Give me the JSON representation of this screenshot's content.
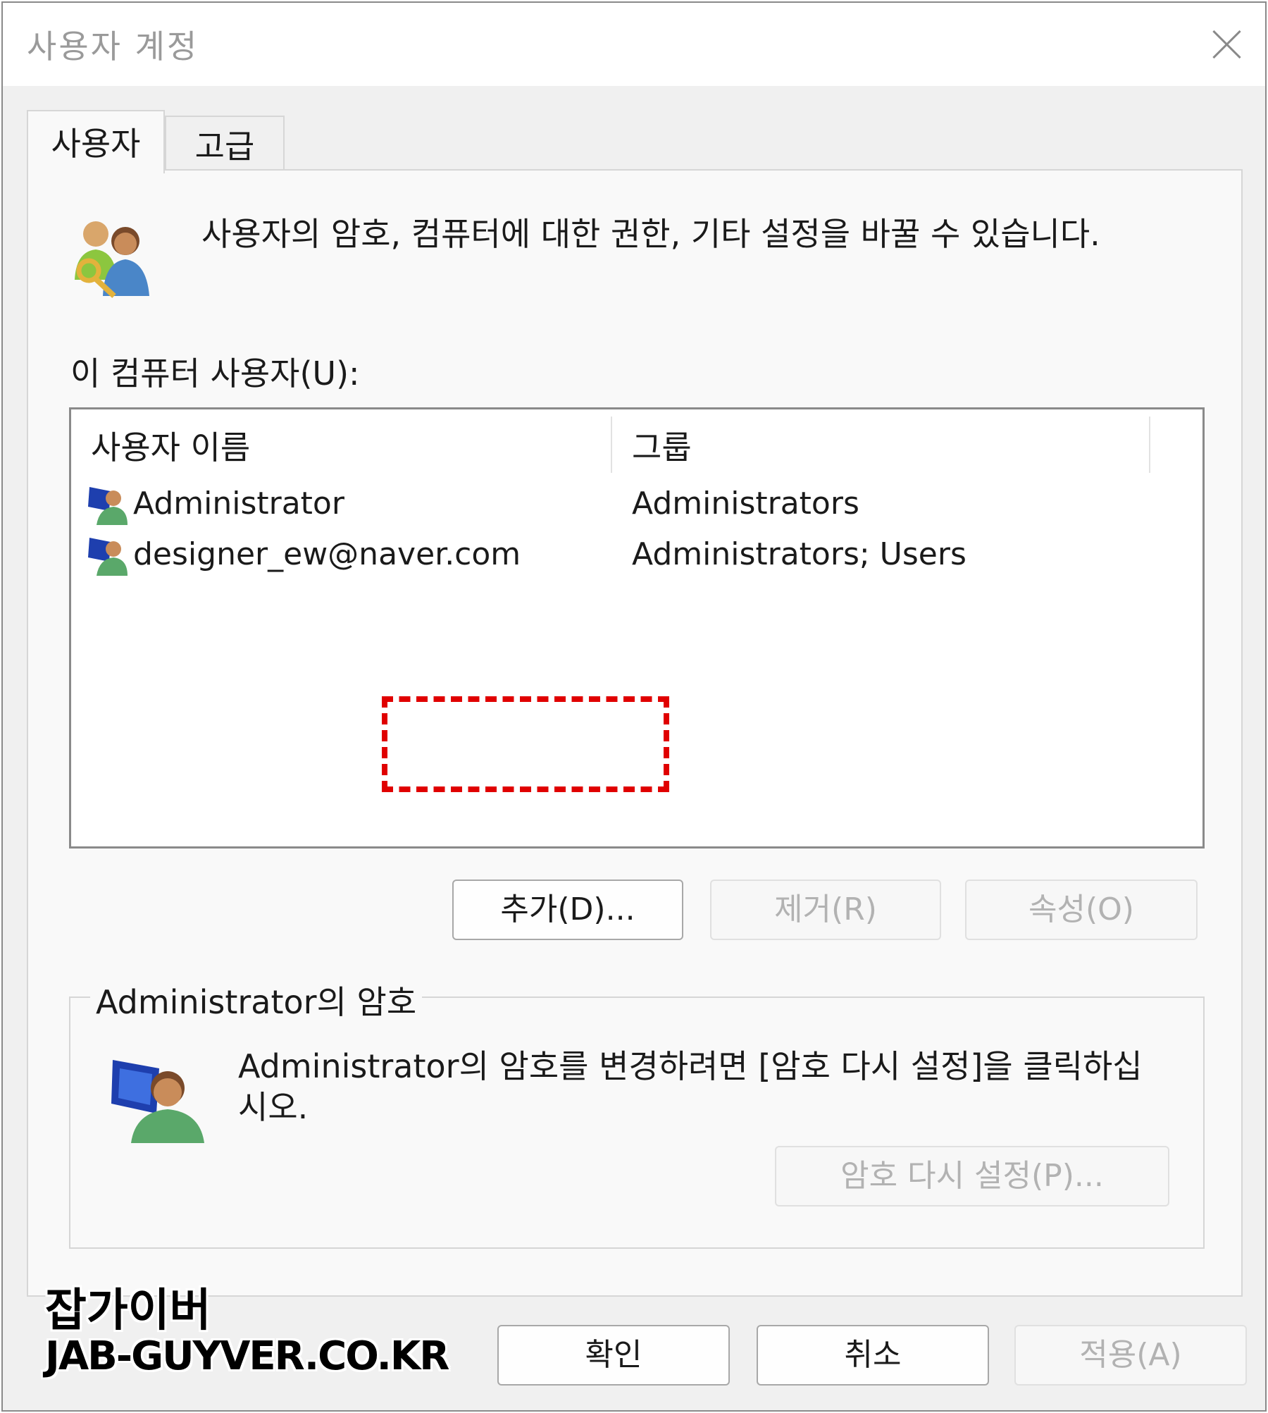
{
  "window": {
    "title": "사용자 계정"
  },
  "tabs": [
    {
      "label": "사용자"
    },
    {
      "label": "고급"
    }
  ],
  "users_tab": {
    "description": "사용자의 암호, 컴퓨터에 대한 권한, 기타 설정을 바꿀 수 있습니다.",
    "list_label": "이 컴퓨터 사용자(U):",
    "columns": [
      "사용자 이름",
      "그룹"
    ],
    "rows": [
      {
        "name": "Administrator",
        "group": "Administrators"
      },
      {
        "name": "designer_ew@naver.com",
        "group": "Administrators; Users"
      }
    ],
    "buttons": {
      "add": "추가(D)...",
      "remove": "제거(R)",
      "properties": "속성(O)"
    }
  },
  "password_group": {
    "title": "Administrator의 암호",
    "text": "Administrator의 암호를 변경하려면 [암호 다시 설정]을 클릭하십시오.",
    "reset_button": "암호 다시 설정(P)..."
  },
  "footer": {
    "ok": "확인",
    "cancel": "취소",
    "apply": "적용(A)"
  },
  "watermark": {
    "line1": "잡가이버",
    "line2": "JAB-GUYVER.CO.KR"
  },
  "icons": {
    "close": "close-icon",
    "users": "users-key-icon",
    "user": "user-computer-icon"
  },
  "colors": {
    "highlight": "#e00000"
  }
}
